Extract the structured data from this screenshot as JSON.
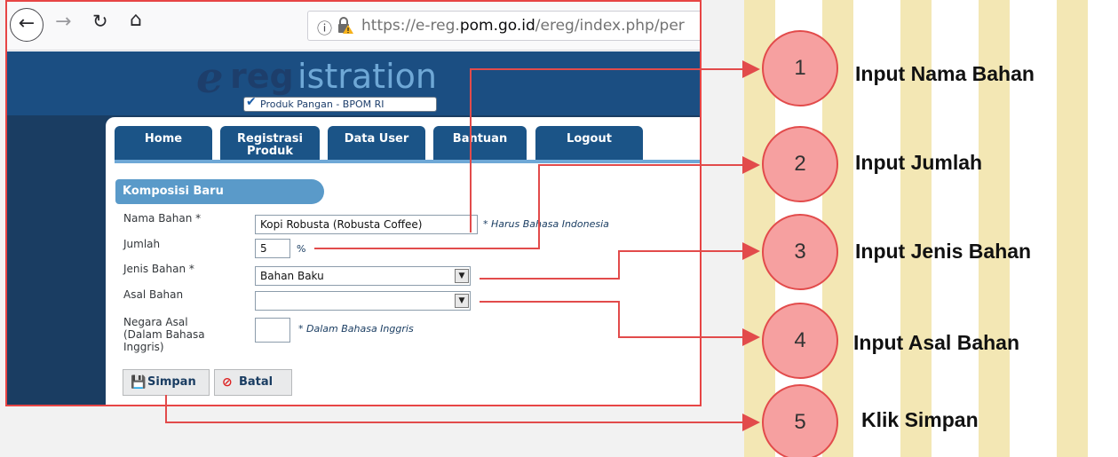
{
  "browser": {
    "url_prefix": "https://e-reg.",
    "url_domain": "pom.go.id",
    "url_suffix": "/ereg/index.php/per"
  },
  "site": {
    "logo_e": "e",
    "logo_reg": "reg",
    "logo_istration": "istration",
    "logo_sub": "Produk Pangan - BPOM RI",
    "tabs": [
      {
        "label": "Home"
      },
      {
        "label": "Registrasi Produk"
      },
      {
        "label": "Data User"
      },
      {
        "label": "Bantuan"
      },
      {
        "label": "Logout"
      }
    ]
  },
  "form": {
    "title": "Komposisi Baru",
    "nama_label": "Nama Bahan *",
    "nama_value": "Kopi Robusta (Robusta Coffee)",
    "nama_hint": "* Harus Bahasa Indonesia",
    "jumlah_label": "Jumlah",
    "jumlah_value": "5",
    "jumlah_unit": "%",
    "jenis_label": "Jenis Bahan *",
    "jenis_value": "Bahan Baku",
    "asal_label": "Asal Bahan",
    "asal_value": "",
    "negara_label": "Negara Asal (Dalam Bahasa Inggris)",
    "negara_value": "",
    "negara_hint": "* Dalam Bahasa Inggris",
    "save_label": "Simpan",
    "cancel_label": "Batal"
  },
  "annotations": [
    {
      "num": "1",
      "text": "Input Nama Bahan"
    },
    {
      "num": "2",
      "text": "Input Jumlah"
    },
    {
      "num": "3",
      "text": "Input Jenis Bahan"
    },
    {
      "num": "4",
      "text": "Input Asal Bahan"
    },
    {
      "num": "5",
      "text": "Klik Simpan"
    }
  ],
  "colors": {
    "annotation_red": "#e24b4b",
    "bubble_fill": "#f6a0a0",
    "stripe_yellow": "#f3e7b4",
    "site_navy": "#1b4e82"
  }
}
